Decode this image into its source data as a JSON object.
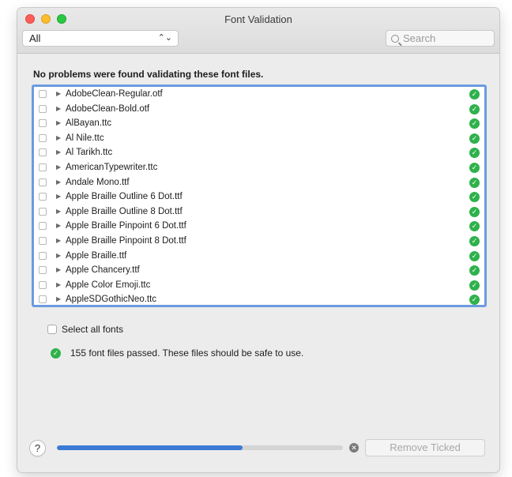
{
  "window": {
    "title": "Font Validation"
  },
  "toolbar": {
    "filter_value": "All",
    "search_placeholder": "Search"
  },
  "status_heading": "No problems were found validating these font files.",
  "fonts": [
    {
      "name": "AdobeClean-Regular.otf"
    },
    {
      "name": "AdobeClean-Bold.otf"
    },
    {
      "name": "AlBayan.ttc"
    },
    {
      "name": "Al Nile.ttc"
    },
    {
      "name": "Al Tarikh.ttc"
    },
    {
      "name": "AmericanTypewriter.ttc"
    },
    {
      "name": "Andale Mono.ttf"
    },
    {
      "name": "Apple Braille Outline 6 Dot.ttf"
    },
    {
      "name": "Apple Braille Outline 8 Dot.ttf"
    },
    {
      "name": "Apple Braille Pinpoint 6 Dot.ttf"
    },
    {
      "name": "Apple Braille Pinpoint 8 Dot.ttf"
    },
    {
      "name": "Apple Braille.ttf"
    },
    {
      "name": "Apple Chancery.ttf"
    },
    {
      "name": "Apple Color Emoji.ttc"
    },
    {
      "name": "AppleSDGothicNeo.ttc"
    }
  ],
  "select_all_label": "Select all fonts",
  "summary": "155 font files passed. These files should be safe to use.",
  "progress": {
    "fraction": 0.65
  },
  "remove_button_label": "Remove Ticked",
  "help_label": "?",
  "icons": {
    "status_ok": "checkmark-circle-icon",
    "stop": "stop-circle-icon",
    "expand": "disclosure-triangle-icon"
  },
  "colors": {
    "accent": "#3a7bd5",
    "ok_green": "#2fb14c",
    "list_focus_ring": "#6b9bdf"
  }
}
